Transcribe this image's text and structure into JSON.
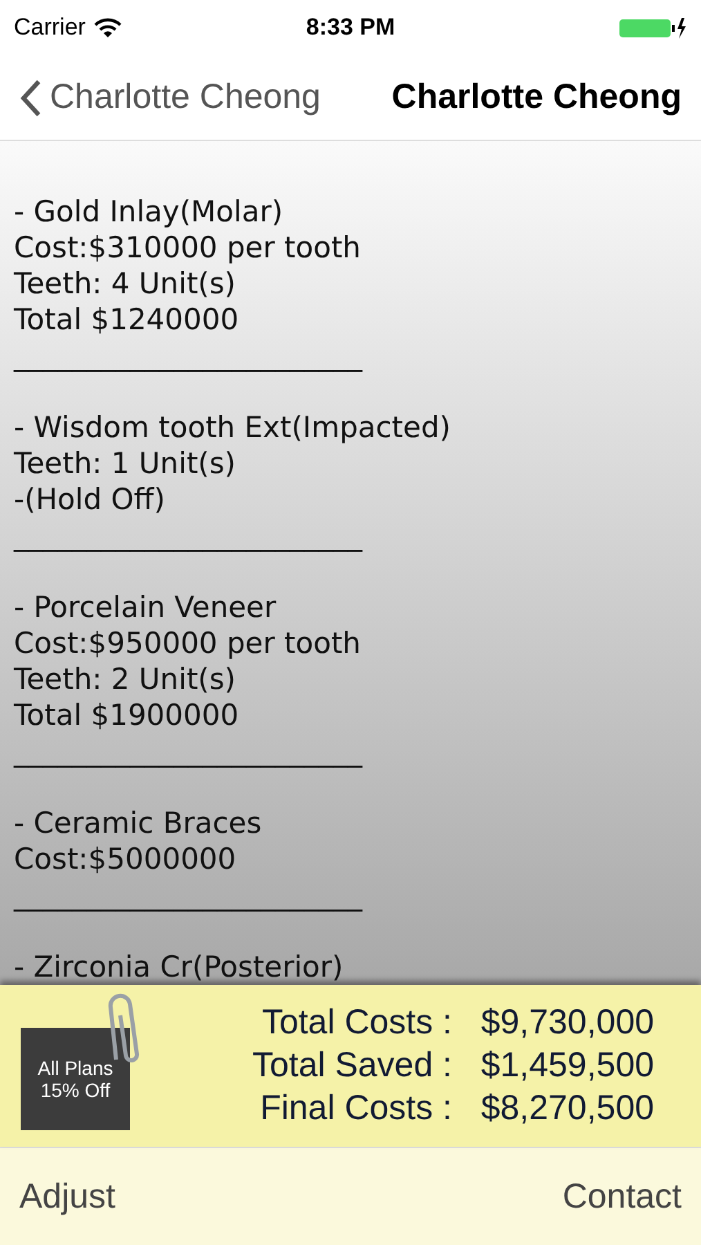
{
  "status_bar": {
    "carrier": "Carrier",
    "time": "8:33 PM"
  },
  "nav": {
    "back_label": "Charlotte Cheong",
    "title": "Charlotte Cheong"
  },
  "items": [
    {
      "lines": [
        "- Gold Inlay(Molar)",
        "Cost:$310000 per tooth",
        "Teeth: 4 Unit(s)",
        "Total $1240000"
      ],
      "separator": "________________________"
    },
    {
      "lines": [
        "- Wisdom tooth Ext(Impacted)",
        "Teeth: 1 Unit(s)",
        "-(Hold Off)"
      ],
      "separator": "________________________"
    },
    {
      "lines": [
        "- Porcelain Veneer",
        "Cost:$950000 per tooth",
        "Teeth: 2 Unit(s)",
        "Total $1900000"
      ],
      "separator": "________________________"
    },
    {
      "lines": [
        "- Ceramic Braces",
        "Cost:$5000000"
      ],
      "separator": "________________________"
    },
    {
      "lines": [
        "- Zirconia Cr(Posterior)"
      ]
    }
  ],
  "promo": {
    "line1": "All Plans",
    "line2": "15% Off"
  },
  "summary": [
    {
      "label": "Total Costs :",
      "value": "$9,730,000"
    },
    {
      "label": "Total Saved :",
      "value": "$1,459,500"
    },
    {
      "label": "Final Costs :",
      "value": "$8,270,500"
    }
  ],
  "toolbar": {
    "left": "Adjust",
    "right": "Contact"
  }
}
